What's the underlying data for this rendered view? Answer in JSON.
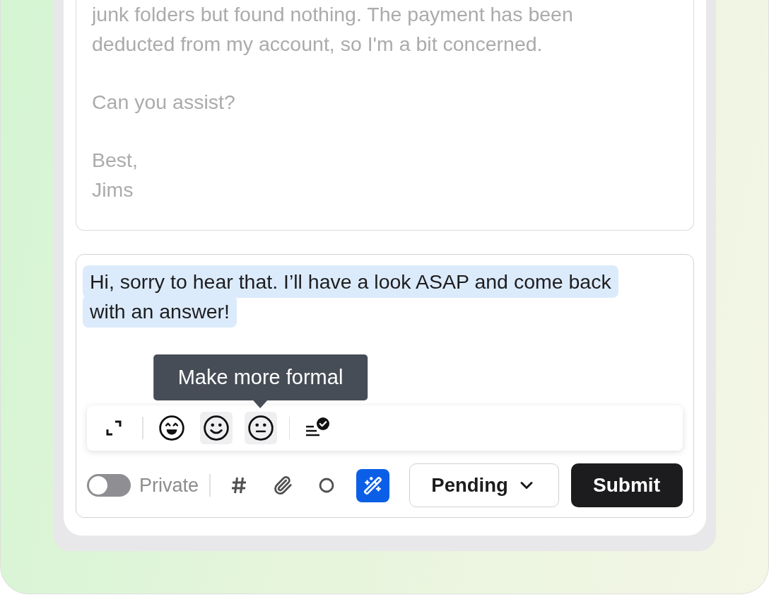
{
  "message": {
    "paragraphs": [
      [
        "junk folders but found nothing. The payment has been",
        "deducted from my account, so I'm a bit concerned."
      ],
      [
        "Can you assist?"
      ],
      [
        "Best,",
        "Jims"
      ]
    ]
  },
  "reply": {
    "text": "Hi, sorry to hear that. I’ll have a look ASAP and come back with an answer!",
    "highlighted": true,
    "toolbar": {
      "left": [
        {
          "kind": "expand"
        }
      ],
      "tones": [
        {
          "kind": "grin",
          "highlighted": false
        },
        {
          "kind": "smile",
          "highlighted": true
        },
        {
          "kind": "neutral",
          "highlighted": true,
          "tooltip": "Make more formal"
        }
      ],
      "right": [
        {
          "kind": "proofread"
        }
      ]
    },
    "private_toggle": {
      "label": "Private",
      "on": false
    },
    "tools": [
      {
        "kind": "hash",
        "active": false
      },
      {
        "kind": "attach",
        "active": false
      },
      {
        "kind": "circle",
        "active": false
      },
      {
        "kind": "magic",
        "active": true
      }
    ],
    "status_select": {
      "value": "Pending"
    },
    "submit": {
      "label": "Submit"
    }
  }
}
